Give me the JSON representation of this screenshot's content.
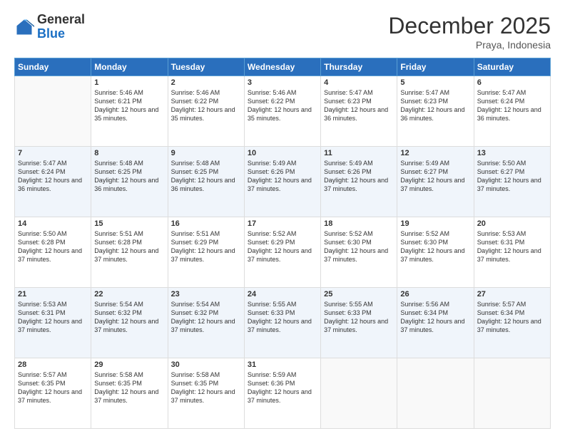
{
  "logo": {
    "general": "General",
    "blue": "Blue"
  },
  "header": {
    "month": "December 2025",
    "location": "Praya, Indonesia"
  },
  "weekdays": [
    "Sunday",
    "Monday",
    "Tuesday",
    "Wednesday",
    "Thursday",
    "Friday",
    "Saturday"
  ],
  "weeks": [
    [
      {
        "day": "",
        "sunrise": "",
        "sunset": "",
        "daylight": ""
      },
      {
        "day": "1",
        "sunrise": "Sunrise: 5:46 AM",
        "sunset": "Sunset: 6:21 PM",
        "daylight": "Daylight: 12 hours and 35 minutes."
      },
      {
        "day": "2",
        "sunrise": "Sunrise: 5:46 AM",
        "sunset": "Sunset: 6:22 PM",
        "daylight": "Daylight: 12 hours and 35 minutes."
      },
      {
        "day": "3",
        "sunrise": "Sunrise: 5:46 AM",
        "sunset": "Sunset: 6:22 PM",
        "daylight": "Daylight: 12 hours and 35 minutes."
      },
      {
        "day": "4",
        "sunrise": "Sunrise: 5:47 AM",
        "sunset": "Sunset: 6:23 PM",
        "daylight": "Daylight: 12 hours and 36 minutes."
      },
      {
        "day": "5",
        "sunrise": "Sunrise: 5:47 AM",
        "sunset": "Sunset: 6:23 PM",
        "daylight": "Daylight: 12 hours and 36 minutes."
      },
      {
        "day": "6",
        "sunrise": "Sunrise: 5:47 AM",
        "sunset": "Sunset: 6:24 PM",
        "daylight": "Daylight: 12 hours and 36 minutes."
      }
    ],
    [
      {
        "day": "7",
        "sunrise": "Sunrise: 5:47 AM",
        "sunset": "Sunset: 6:24 PM",
        "daylight": "Daylight: 12 hours and 36 minutes."
      },
      {
        "day": "8",
        "sunrise": "Sunrise: 5:48 AM",
        "sunset": "Sunset: 6:25 PM",
        "daylight": "Daylight: 12 hours and 36 minutes."
      },
      {
        "day": "9",
        "sunrise": "Sunrise: 5:48 AM",
        "sunset": "Sunset: 6:25 PM",
        "daylight": "Daylight: 12 hours and 36 minutes."
      },
      {
        "day": "10",
        "sunrise": "Sunrise: 5:49 AM",
        "sunset": "Sunset: 6:26 PM",
        "daylight": "Daylight: 12 hours and 37 minutes."
      },
      {
        "day": "11",
        "sunrise": "Sunrise: 5:49 AM",
        "sunset": "Sunset: 6:26 PM",
        "daylight": "Daylight: 12 hours and 37 minutes."
      },
      {
        "day": "12",
        "sunrise": "Sunrise: 5:49 AM",
        "sunset": "Sunset: 6:27 PM",
        "daylight": "Daylight: 12 hours and 37 minutes."
      },
      {
        "day": "13",
        "sunrise": "Sunrise: 5:50 AM",
        "sunset": "Sunset: 6:27 PM",
        "daylight": "Daylight: 12 hours and 37 minutes."
      }
    ],
    [
      {
        "day": "14",
        "sunrise": "Sunrise: 5:50 AM",
        "sunset": "Sunset: 6:28 PM",
        "daylight": "Daylight: 12 hours and 37 minutes."
      },
      {
        "day": "15",
        "sunrise": "Sunrise: 5:51 AM",
        "sunset": "Sunset: 6:28 PM",
        "daylight": "Daylight: 12 hours and 37 minutes."
      },
      {
        "day": "16",
        "sunrise": "Sunrise: 5:51 AM",
        "sunset": "Sunset: 6:29 PM",
        "daylight": "Daylight: 12 hours and 37 minutes."
      },
      {
        "day": "17",
        "sunrise": "Sunrise: 5:52 AM",
        "sunset": "Sunset: 6:29 PM",
        "daylight": "Daylight: 12 hours and 37 minutes."
      },
      {
        "day": "18",
        "sunrise": "Sunrise: 5:52 AM",
        "sunset": "Sunset: 6:30 PM",
        "daylight": "Daylight: 12 hours and 37 minutes."
      },
      {
        "day": "19",
        "sunrise": "Sunrise: 5:52 AM",
        "sunset": "Sunset: 6:30 PM",
        "daylight": "Daylight: 12 hours and 37 minutes."
      },
      {
        "day": "20",
        "sunrise": "Sunrise: 5:53 AM",
        "sunset": "Sunset: 6:31 PM",
        "daylight": "Daylight: 12 hours and 37 minutes."
      }
    ],
    [
      {
        "day": "21",
        "sunrise": "Sunrise: 5:53 AM",
        "sunset": "Sunset: 6:31 PM",
        "daylight": "Daylight: 12 hours and 37 minutes."
      },
      {
        "day": "22",
        "sunrise": "Sunrise: 5:54 AM",
        "sunset": "Sunset: 6:32 PM",
        "daylight": "Daylight: 12 hours and 37 minutes."
      },
      {
        "day": "23",
        "sunrise": "Sunrise: 5:54 AM",
        "sunset": "Sunset: 6:32 PM",
        "daylight": "Daylight: 12 hours and 37 minutes."
      },
      {
        "day": "24",
        "sunrise": "Sunrise: 5:55 AM",
        "sunset": "Sunset: 6:33 PM",
        "daylight": "Daylight: 12 hours and 37 minutes."
      },
      {
        "day": "25",
        "sunrise": "Sunrise: 5:55 AM",
        "sunset": "Sunset: 6:33 PM",
        "daylight": "Daylight: 12 hours and 37 minutes."
      },
      {
        "day": "26",
        "sunrise": "Sunrise: 5:56 AM",
        "sunset": "Sunset: 6:34 PM",
        "daylight": "Daylight: 12 hours and 37 minutes."
      },
      {
        "day": "27",
        "sunrise": "Sunrise: 5:57 AM",
        "sunset": "Sunset: 6:34 PM",
        "daylight": "Daylight: 12 hours and 37 minutes."
      }
    ],
    [
      {
        "day": "28",
        "sunrise": "Sunrise: 5:57 AM",
        "sunset": "Sunset: 6:35 PM",
        "daylight": "Daylight: 12 hours and 37 minutes."
      },
      {
        "day": "29",
        "sunrise": "Sunrise: 5:58 AM",
        "sunset": "Sunset: 6:35 PM",
        "daylight": "Daylight: 12 hours and 37 minutes."
      },
      {
        "day": "30",
        "sunrise": "Sunrise: 5:58 AM",
        "sunset": "Sunset: 6:35 PM",
        "daylight": "Daylight: 12 hours and 37 minutes."
      },
      {
        "day": "31",
        "sunrise": "Sunrise: 5:59 AM",
        "sunset": "Sunset: 6:36 PM",
        "daylight": "Daylight: 12 hours and 37 minutes."
      },
      {
        "day": "",
        "sunrise": "",
        "sunset": "",
        "daylight": ""
      },
      {
        "day": "",
        "sunrise": "",
        "sunset": "",
        "daylight": ""
      },
      {
        "day": "",
        "sunrise": "",
        "sunset": "",
        "daylight": ""
      }
    ]
  ]
}
